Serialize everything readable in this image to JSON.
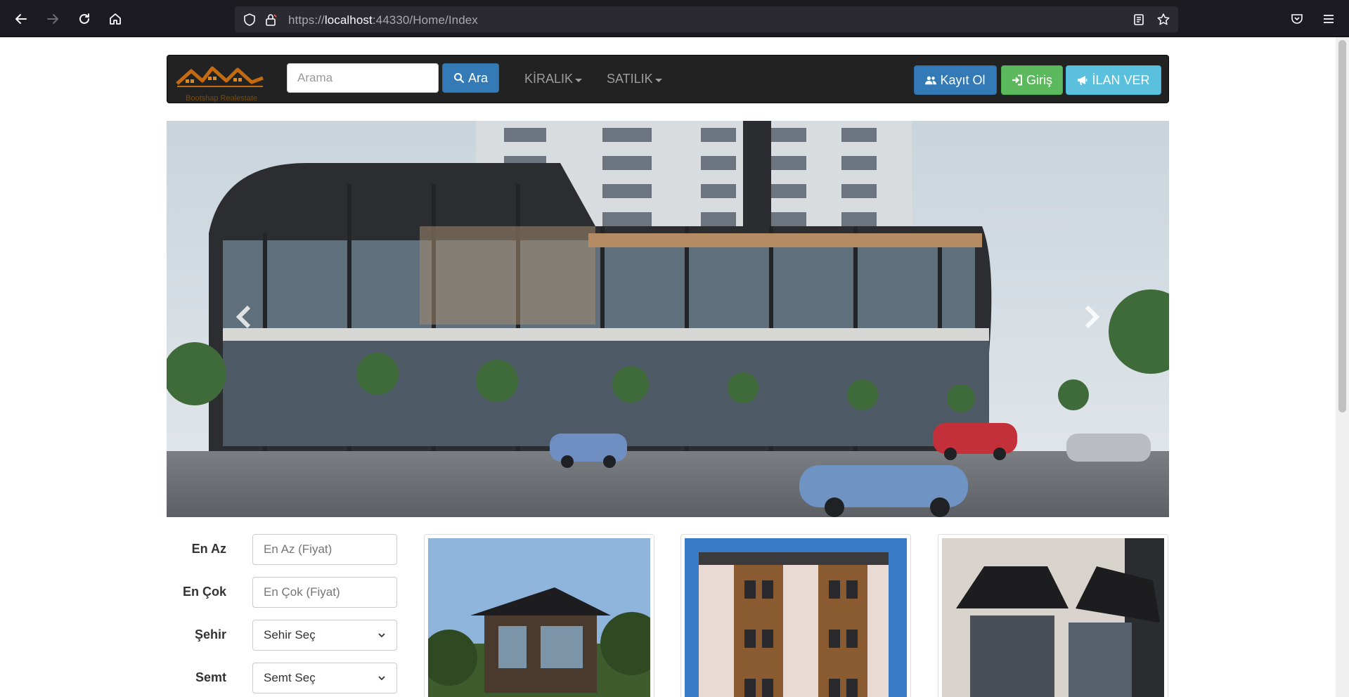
{
  "browser": {
    "url_prefix": "https://",
    "url_host": "localhost",
    "url_rest": ":44330/Home/Index"
  },
  "navbar": {
    "logo_text": "Bootshap Realestate",
    "search_placeholder": "Arama",
    "search_button": "Ara",
    "menu_kiralik": "KİRALIK",
    "menu_satilik": "SATILIK",
    "register_button": "Kayıt Ol",
    "login_button": "Giriş",
    "post_ad_button": "İLAN VER"
  },
  "carousel": {
    "prev_icon": "chevron-left-icon",
    "next_icon": "chevron-right-icon"
  },
  "filters": {
    "min_label": "En Az",
    "min_placeholder": "En Az (Fiyat)",
    "max_label": "En Çok",
    "max_placeholder": "En Çok (Fiyat)",
    "city_label": "Şehir",
    "city_value": "Sehir Seç",
    "district_label": "Semt",
    "district_value": "Semt Seç"
  },
  "colors": {
    "primary": "#337ab7",
    "success": "#5cb85c",
    "info": "#5bc0de",
    "navbar_bg": "#222222"
  }
}
